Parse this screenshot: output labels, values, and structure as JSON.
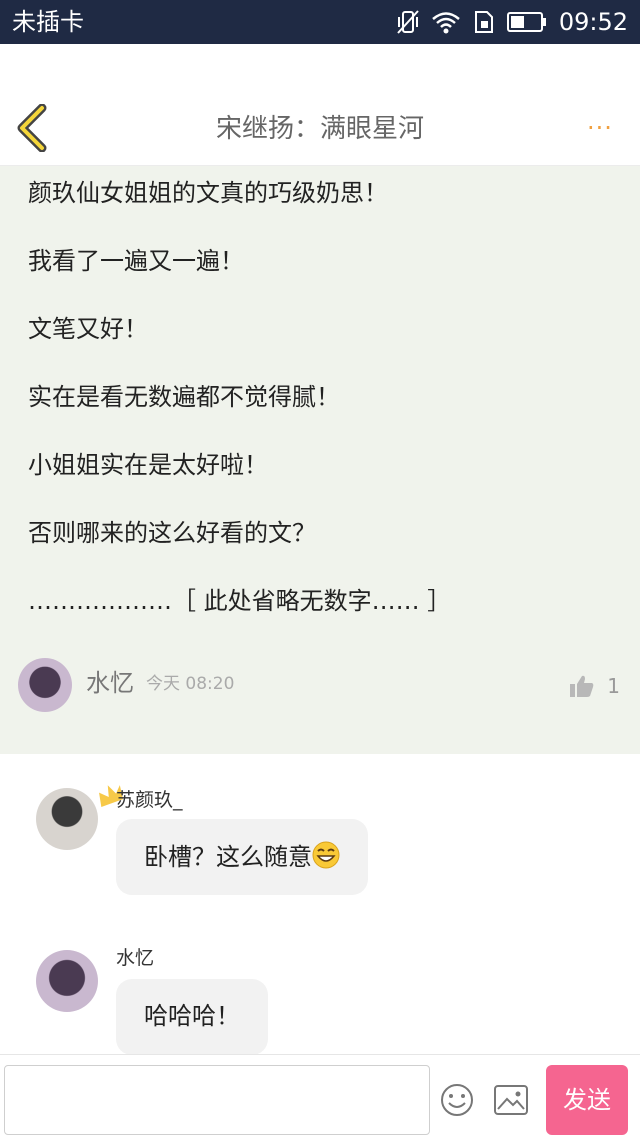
{
  "status_bar": {
    "carrier": "未插卡",
    "time": "09:52"
  },
  "header": {
    "title": "宋继扬：满眼星河",
    "more": "···"
  },
  "post": {
    "lines": [
      "颜玖仙女姐姐的文真的巧级奶思！",
      "我看了一遍又一遍！",
      "文笔又好！",
      "实在是看无数遍都不觉得腻！",
      "小姐姐实在是太好啦！",
      "否则哪来的这么好看的文？",
      "………………［ 此处省略无数字…… ］"
    ],
    "author": "水忆",
    "time": "今天 08:20",
    "likes": "1"
  },
  "comments": [
    {
      "name": "苏颜玖_",
      "text": "卧槽？这么随意",
      "has_emoji": true,
      "crown": true
    },
    {
      "name": "水忆",
      "text": "哈哈哈！",
      "has_emoji": false,
      "crown": false
    }
  ],
  "input_bar": {
    "placeholder": "",
    "send_label": "发送"
  },
  "colors": {
    "status_bar": "#1f2a44",
    "post_bg": "#f0f3ec",
    "send": "#f56590",
    "accent": "#f0a040"
  },
  "icons": [
    "back-icon",
    "more-icon",
    "thumbs-up-icon",
    "crown-icon",
    "grin-emoji-icon",
    "emoji-icon",
    "image-icon"
  ]
}
